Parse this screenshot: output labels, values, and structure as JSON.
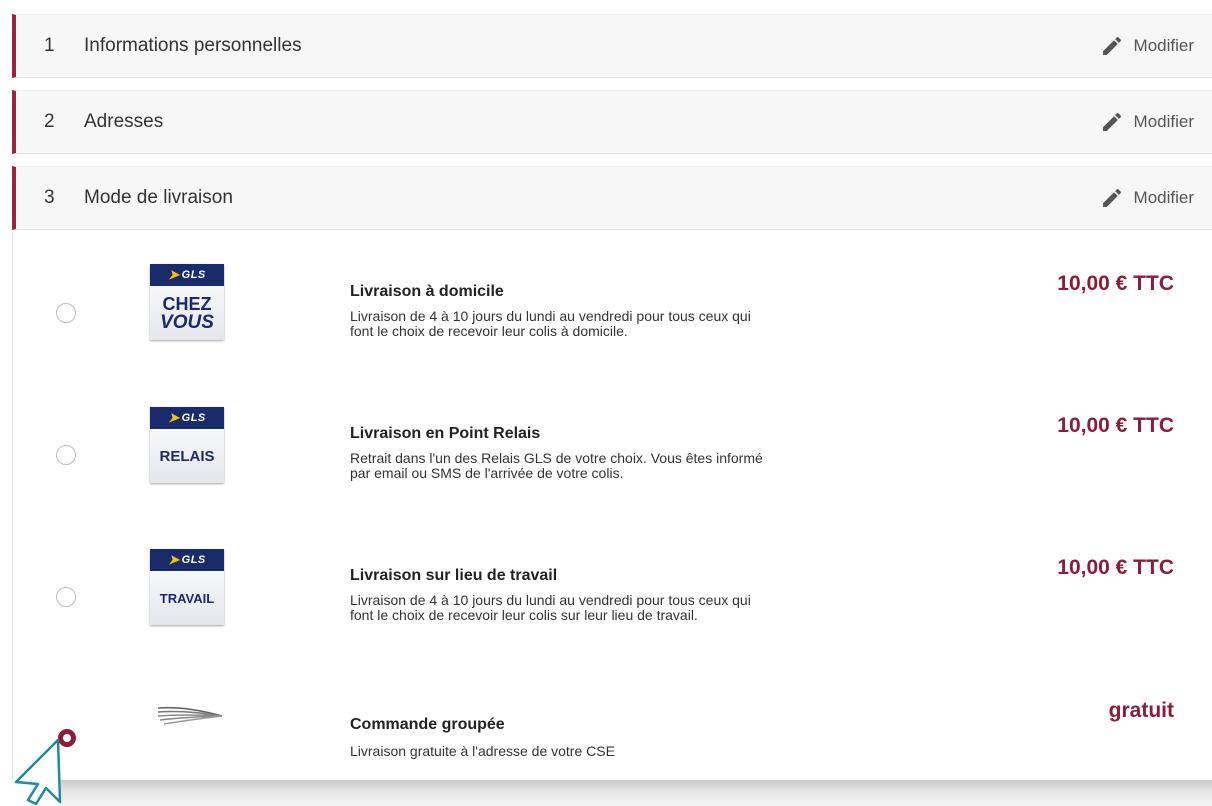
{
  "steps": [
    {
      "number": "1",
      "title": "Informations personnelles",
      "action": "Modifier"
    },
    {
      "number": "2",
      "title": "Adresses",
      "action": "Modifier"
    },
    {
      "number": "3",
      "title": "Mode de livraison",
      "action": "Modifier"
    }
  ],
  "options": [
    {
      "logo_brand": "GLS",
      "logo_line1": "CHEZ",
      "logo_line2": "VOUS",
      "title": "Livraison à domicile",
      "desc_line1": "Livraison de 4 à 10 jours du lundi au vendredi pour tous ceux qui",
      "desc_line2": "font le choix de recevoir leur colis à domicile.",
      "price": "10,00 € TTC",
      "selected": false
    },
    {
      "logo_brand": "GLS",
      "logo_text": "RELAIS",
      "title": "Livraison en Point Relais",
      "desc_line1": "Retrait dans l'un des Relais GLS de votre choix. Vous êtes informé",
      "desc_line2": "par email ou SMS de l'arrivée de votre colis.",
      "price": "10,00 € TTC",
      "selected": false
    },
    {
      "logo_brand": "GLS",
      "logo_text": "TRAVAIL",
      "title": "Livraison sur lieu de travail",
      "desc_line1": "Livraison de 4 à 10 jours du lundi au vendredi pour tous ceux qui",
      "desc_line2": "font le choix de recevoir leur colis sur leur lieu de travail.",
      "price": "10,00 € TTC",
      "selected": false
    },
    {
      "title": "Commande groupée",
      "desc_line1": "Livraison gratuite à l'adresse de votre CSE",
      "price": "gratuit",
      "selected": true
    }
  ],
  "icons": {
    "edit": "pencil-icon",
    "cursor": "mouse-pointer-icon"
  },
  "colors": {
    "accent": "#8c1d38",
    "gls_blue": "#1a2b6b",
    "gls_yellow": "#f7c200"
  }
}
